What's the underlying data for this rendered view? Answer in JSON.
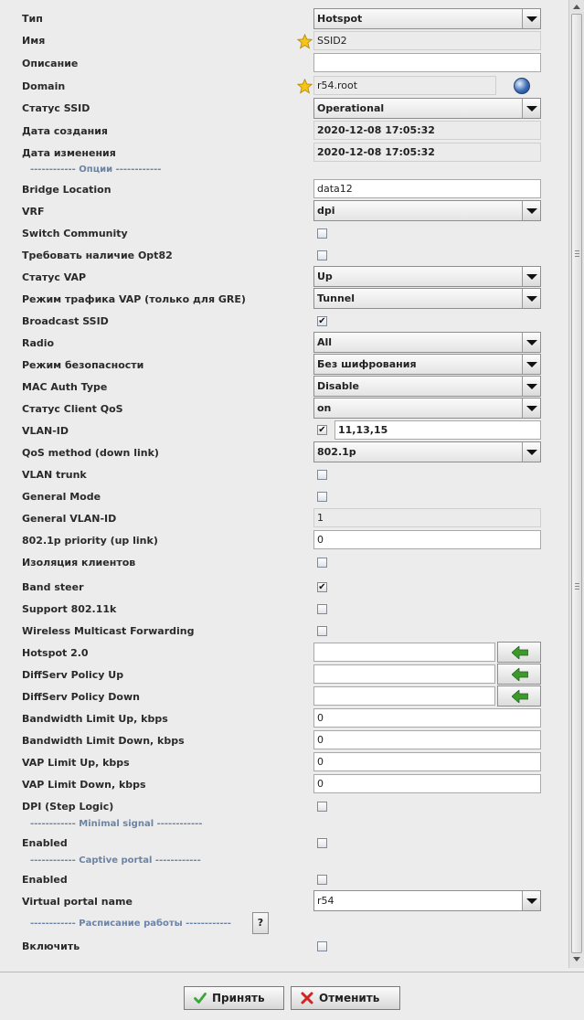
{
  "form": {
    "type": {
      "label": "Тип",
      "value": "Hotspot"
    },
    "name": {
      "label": "Имя",
      "value": "SSID2"
    },
    "description": {
      "label": "Описание",
      "value": ""
    },
    "domain": {
      "label": "Domain",
      "value": "r54.root"
    },
    "ssid_status": {
      "label": "Статус SSID",
      "value": "Operational"
    },
    "created": {
      "label": "Дата создания",
      "value": "2020-12-08 17:05:32"
    },
    "modified": {
      "label": "Дата изменения",
      "value": "2020-12-08 17:05:32"
    },
    "section_options": "------------ Опции ------------",
    "bridge_location": {
      "label": "Bridge Location",
      "value": "data12"
    },
    "vrf": {
      "label": "VRF",
      "value": "dpi"
    },
    "switch_community": {
      "label": "Switch Community",
      "checked": false
    },
    "require_opt82": {
      "label": "Требовать наличие Opt82",
      "checked": false
    },
    "vap_status": {
      "label": "Статус VAP",
      "value": "Up"
    },
    "vap_traffic_mode": {
      "label": "Режим трафика VAP (только для GRE)",
      "value": "Tunnel"
    },
    "broadcast_ssid": {
      "label": "Broadcast SSID",
      "checked": true
    },
    "radio": {
      "label": "Radio",
      "value": "All"
    },
    "security_mode": {
      "label": "Режим безопасности",
      "value": "Без шифрования"
    },
    "mac_auth_type": {
      "label": "MAC Auth Type",
      "value": "Disable"
    },
    "client_qos_status": {
      "label": "Статус Client QoS",
      "value": "on"
    },
    "vlan_id": {
      "label": "VLAN-ID",
      "checked": true,
      "value": "11,13,15"
    },
    "qos_method": {
      "label": "QoS method (down link)",
      "value": "802.1p"
    },
    "vlan_trunk": {
      "label": "VLAN trunk",
      "checked": false
    },
    "general_mode": {
      "label": "General Mode",
      "checked": false
    },
    "general_vlan_id": {
      "label": "General VLAN-ID",
      "value": "1"
    },
    "priority_uplink": {
      "label": "802.1p priority (up link)",
      "value": "0"
    },
    "client_isolation": {
      "label": "Изоляция клиентов",
      "checked": false
    },
    "band_steer": {
      "label": "Band steer",
      "checked": true
    },
    "support_80211k": {
      "label": "Support 802.11k",
      "checked": false
    },
    "wireless_multicast": {
      "label": "Wireless Multicast Forwarding",
      "checked": false
    },
    "hotspot20": {
      "label": "Hotspot 2.0",
      "value": ""
    },
    "diffserv_up": {
      "label": "DiffServ Policy Up",
      "value": ""
    },
    "diffserv_down": {
      "label": "DiffServ Policy Down",
      "value": ""
    },
    "bw_limit_up": {
      "label": "Bandwidth Limit Up, kbps",
      "value": "0"
    },
    "bw_limit_down": {
      "label": "Bandwidth Limit Down, kbps",
      "value": "0"
    },
    "vap_limit_up": {
      "label": "VAP Limit Up, kbps",
      "value": "0"
    },
    "vap_limit_down": {
      "label": "VAP Limit Down, kbps",
      "value": "0"
    },
    "dpi_step_logic": {
      "label": "DPI (Step Logic)",
      "checked": false
    },
    "section_minimal_signal": "------------ Minimal signal ------------",
    "minimal_signal_enabled": {
      "label": "Enabled",
      "checked": false
    },
    "section_captive_portal": "------------ Captive portal ------------",
    "captive_portal_enabled": {
      "label": "Enabled",
      "checked": false
    },
    "virtual_portal_name": {
      "label": "Virtual portal name",
      "value": "r54"
    },
    "section_schedule": "------------ Расписание работы ------------",
    "help_label": "?",
    "schedule_enable": {
      "label": "Включить",
      "checked": false
    }
  },
  "footer": {
    "accept_label": "Принять",
    "cancel_label": "Отменить"
  },
  "colors": {
    "section_text": "#6b84a6",
    "accept_icon": "#3aa53a",
    "cancel_icon": "#d22222",
    "arrow_icon": "#3c9a2c"
  }
}
